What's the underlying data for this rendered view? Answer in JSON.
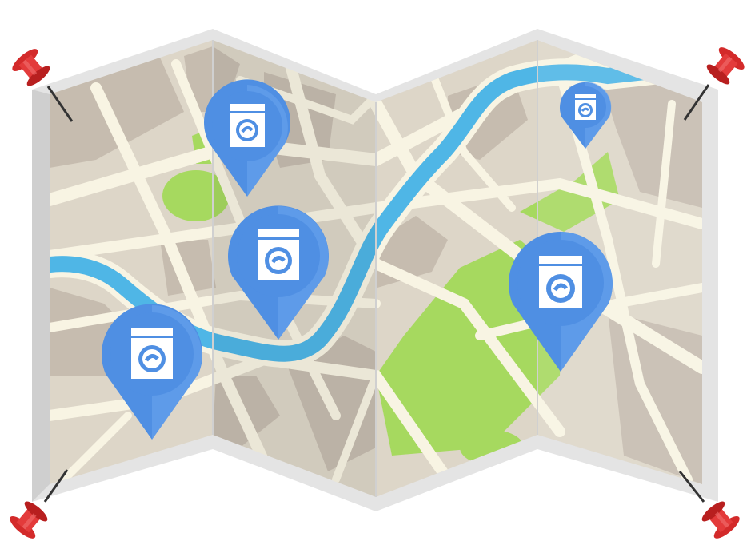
{
  "illustration": {
    "subject": "folded-city-map",
    "panels": 4,
    "pins": [
      {
        "icon": "washing-machine-icon",
        "size": "medium"
      },
      {
        "icon": "washing-machine-icon",
        "size": "large"
      },
      {
        "icon": "washing-machine-icon",
        "size": "large"
      },
      {
        "icon": "washing-machine-icon",
        "size": "small"
      },
      {
        "icon": "washing-machine-icon",
        "size": "large"
      }
    ],
    "thumbtacks": [
      "top-left",
      "top-right",
      "bottom-left",
      "bottom-right"
    ]
  },
  "colors": {
    "land": "#ddd6c8",
    "block": "#c6bcaf",
    "road": "#f8f4e3",
    "river": "#4fb6e6",
    "park": "#a6d95f",
    "pin": "#4f8fe3",
    "pin_light": "#6ea7f0",
    "tack": "#d32a2a",
    "frame": "#dcdcdc"
  }
}
